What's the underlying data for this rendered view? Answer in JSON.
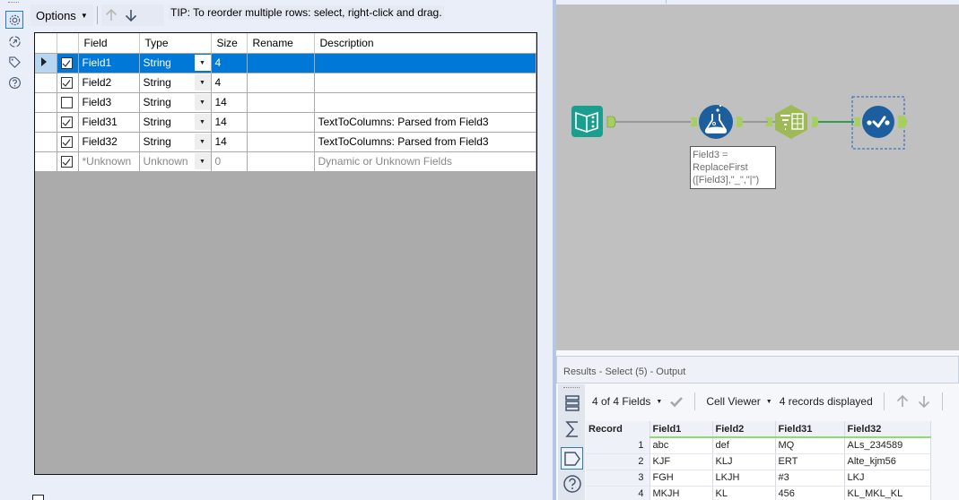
{
  "config": {
    "options_label": "Options",
    "tip": "TIP: To reorder multiple rows: select, right-click and drag.",
    "columns": [
      "Field",
      "Type",
      "Size",
      "Rename",
      "Description"
    ],
    "rows": [
      {
        "checked": true,
        "field": "Field1",
        "type": "String",
        "size": "4",
        "rename": "",
        "description": "",
        "selected": true
      },
      {
        "checked": true,
        "field": "Field2",
        "type": "String",
        "size": "4",
        "rename": "",
        "description": ""
      },
      {
        "checked": false,
        "field": "Field3",
        "type": "String",
        "size": "14",
        "rename": "",
        "description": ""
      },
      {
        "checked": true,
        "field": "Field31",
        "type": "String",
        "size": "14",
        "rename": "",
        "description": "TextToColumns: Parsed from Field3"
      },
      {
        "checked": true,
        "field": "Field32",
        "type": "String",
        "size": "14",
        "rename": "",
        "description": "TextToColumns: Parsed from Field3"
      },
      {
        "checked": true,
        "field": "*Unknown",
        "type": "Unknown",
        "size": "0",
        "rename": "",
        "description": "Dynamic or Unknown Fields",
        "muted": true
      }
    ]
  },
  "canvas": {
    "annotation": [
      "Field3 =",
      "ReplaceFirst",
      "([Field3],\"_\",\"|\")"
    ],
    "tools": [
      "input-data-tool",
      "formula-tool",
      "text-to-columns-tool",
      "select-tool"
    ],
    "colors": {
      "input": "#1a9e8e",
      "formula": "#1c5e9e",
      "parse": "#9fb957",
      "select": "#1c5e9e",
      "connector": "#a6d05e",
      "wire": "#808080",
      "wire_active": "#2e9d4f"
    }
  },
  "results": {
    "title": "Results - Select (5) - Output",
    "fields_label": "4 of 4 Fields",
    "viewer_label": "Cell Viewer",
    "records_label": "4 records displayed",
    "columns": [
      "Record",
      "Field1",
      "Field2",
      "Field31",
      "Field32"
    ],
    "rows": [
      [
        "1",
        "abc",
        "def",
        "MQ",
        "ALs_234589"
      ],
      [
        "2",
        "KJF",
        "KLJ",
        "ERT",
        "Alte_kjm56"
      ],
      [
        "3",
        "FGH",
        "LKJH",
        "#3",
        "LKJ"
      ],
      [
        "4",
        "MKJH",
        "KL",
        "456",
        "KL_MKL_KL"
      ]
    ]
  }
}
